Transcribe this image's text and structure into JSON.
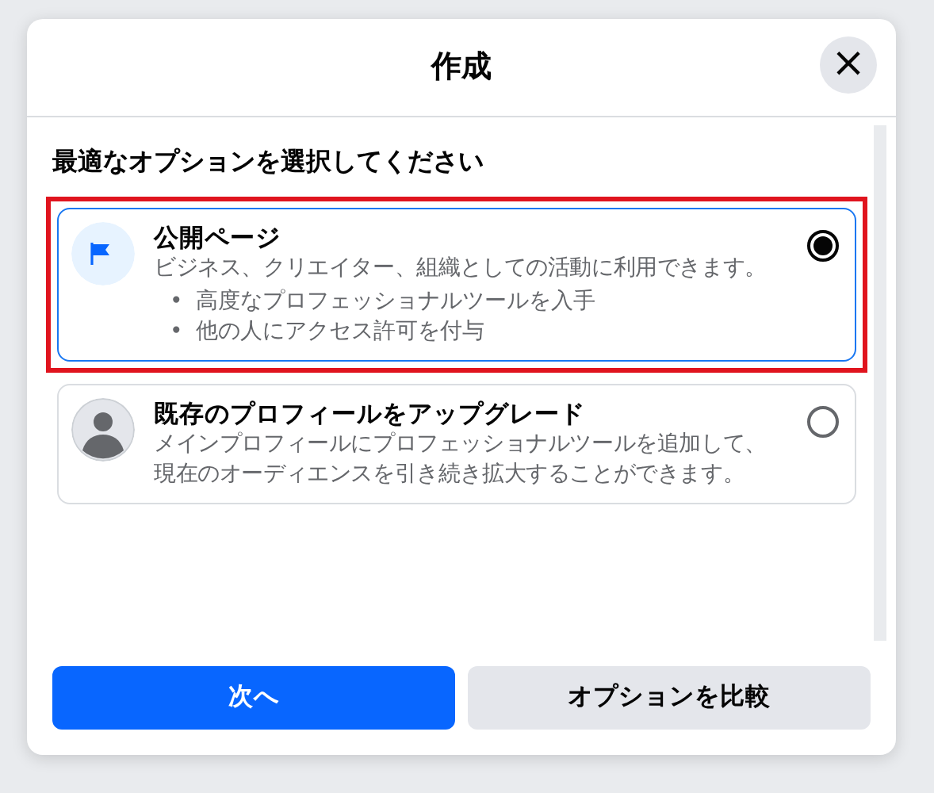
{
  "dialog": {
    "title": "作成",
    "close": "×"
  },
  "prompt": "最適なオプションを選択してください",
  "options": [
    {
      "kind": "page",
      "title": "公開ページ",
      "description": "ビジネス、クリエイター、組織としての活動に利用できます。",
      "bullets": [
        {
          "marker": "•",
          "text": "高度なプロフェッショナルツールを入手"
        },
        {
          "marker": "•",
          "text": "他の人にアクセス許可を付与"
        }
      ],
      "selected": true,
      "highlighted": true
    },
    {
      "kind": "profile",
      "title": "既存のプロフィールをアップグレード",
      "description": "メインプロフィールにプロフェッショナルツールを追加して、現在のオーディエンスを引き続き拡大することができます。",
      "selected": false,
      "highlighted": false
    }
  ],
  "buttons": [
    {
      "label": "次へ",
      "kind": "primary"
    },
    {
      "label": "オプションを比較",
      "kind": "secondary"
    }
  ]
}
